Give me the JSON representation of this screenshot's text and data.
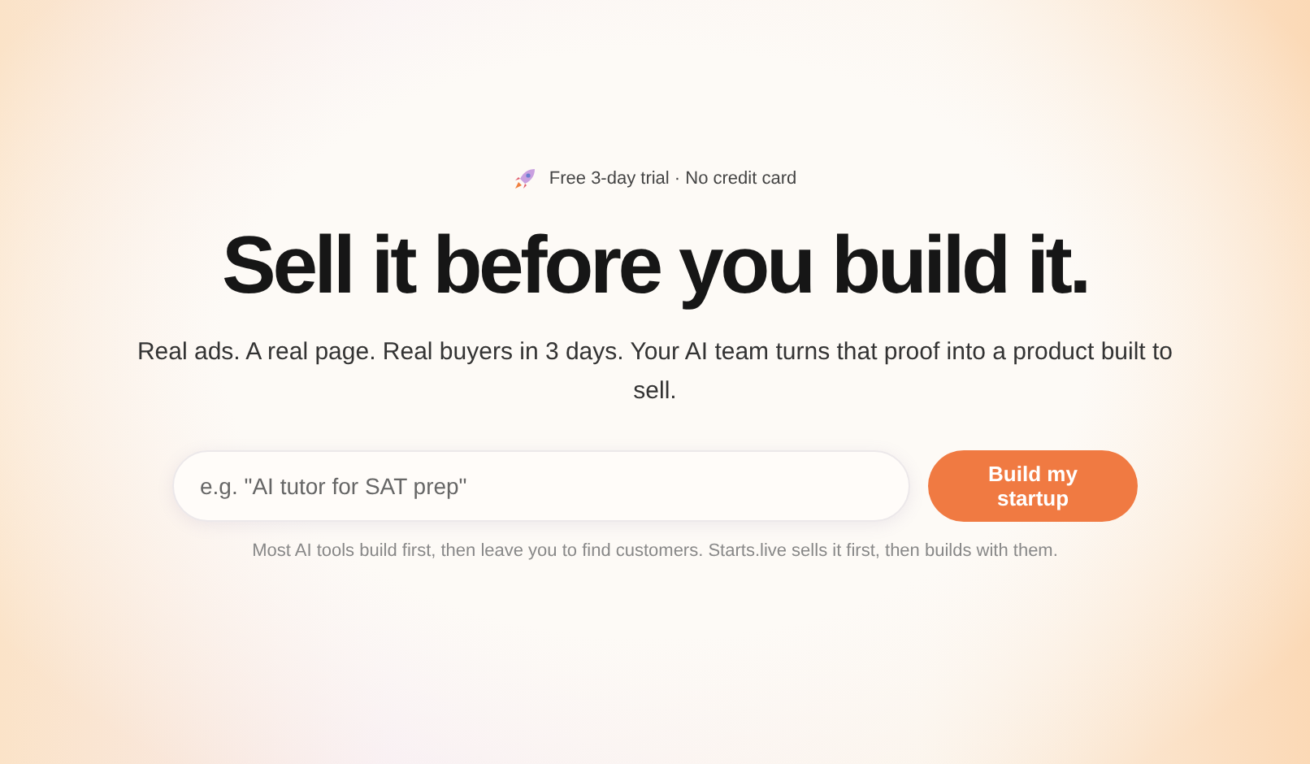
{
  "badge": {
    "text": "Free 3-day trial · No credit card"
  },
  "headline": "Sell it before you build it.",
  "subheadline": "Real ads. A real page. Real buyers in 3 days. Your AI team turns that proof into a product built to sell.",
  "idea_field": {
    "placeholder": "e.g. \"AI tutor for SAT prep\""
  },
  "cta_button": "Build my startup",
  "footnote": "Most AI tools build first, then leave you to find customers. Starts.live sells it first, then builds with them."
}
